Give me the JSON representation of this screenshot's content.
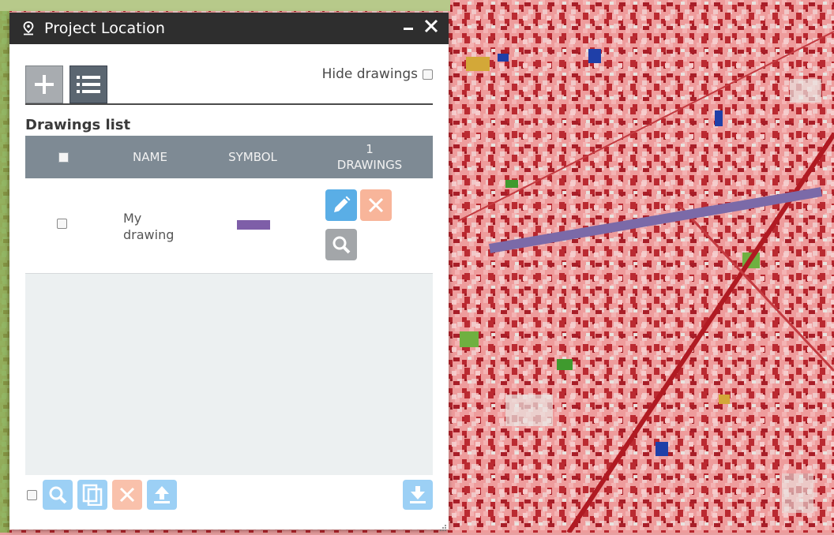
{
  "panel": {
    "title": "Project Location",
    "hide_drawings_label": "Hide drawings",
    "section_title": "Drawings list"
  },
  "table": {
    "headers": {
      "name": "NAME",
      "symbol": "SYMBOL",
      "count": "1",
      "count_label": "DRAWINGS"
    },
    "rows": [
      {
        "name": "My drawing",
        "symbol_color": "#7e5ea8"
      }
    ]
  },
  "colors": {
    "titlebar": "#2e2e2e",
    "header": "#7e8a94",
    "edit": "#5aaee6",
    "delete": "#f8b59a",
    "zoom": "#a3a6a9",
    "footer_button": "#9cd0f5",
    "drawn_line": "#7b6aa8"
  },
  "icons": [
    "map-pin-icon",
    "plus-icon",
    "list-icon",
    "pencil-icon",
    "x-icon",
    "magnifier-icon",
    "copy-icon",
    "upload-icon",
    "download-icon",
    "close-icon",
    "minimize-icon",
    "resize-icon"
  ]
}
